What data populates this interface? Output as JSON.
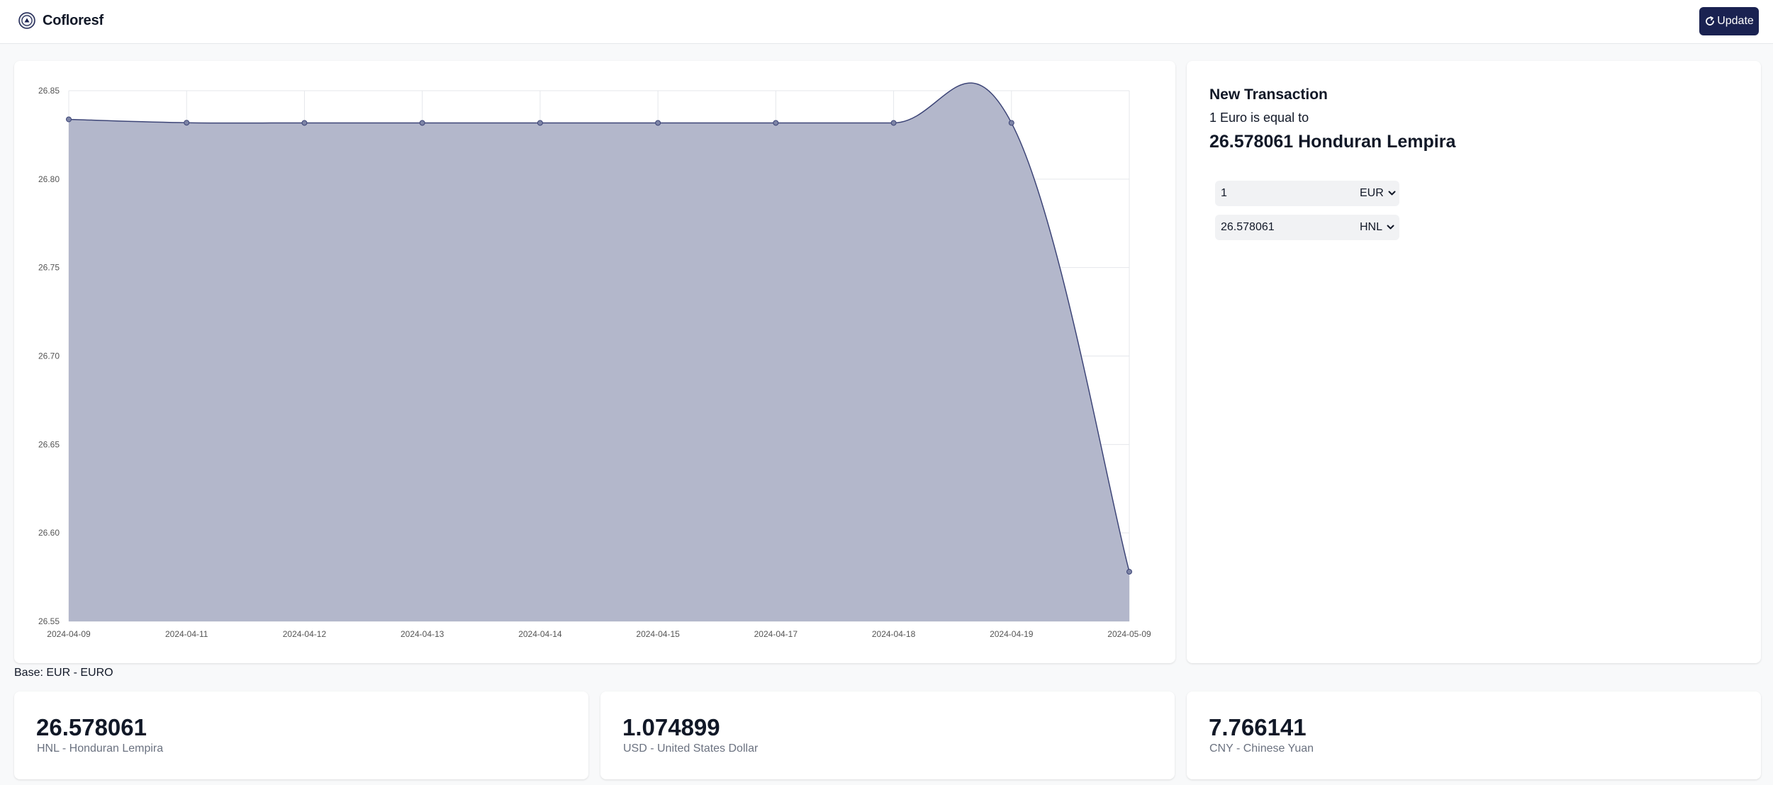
{
  "header": {
    "brand": "Cofloresf",
    "logo_icon": "coin-icon",
    "update_label": "Update",
    "update_icon": "refresh-icon",
    "accent_color": "#1a2251"
  },
  "chart_data": {
    "type": "area",
    "title": "",
    "xlabel": "",
    "ylabel": "",
    "categories": [
      "2024-04-09",
      "2024-04-11",
      "2024-04-12",
      "2024-04-13",
      "2024-04-14",
      "2024-04-15",
      "2024-04-17",
      "2024-04-18",
      "2024-04-19",
      "2024-05-09"
    ],
    "values": [
      26.8338,
      26.8319,
      26.8318,
      26.8318,
      26.8318,
      26.8318,
      26.8318,
      26.8318,
      26.8318,
      26.578061
    ],
    "ylim": [
      26.55,
      26.85
    ],
    "y_ticks": [
      "26.85",
      "26.80",
      "26.75",
      "26.70",
      "26.65",
      "26.60",
      "26.55"
    ],
    "grid": true,
    "fill_color": "#b3b7cb",
    "line_color": "#3d4577"
  },
  "base": {
    "label": "Base: EUR - EURO"
  },
  "transaction": {
    "title": "New Transaction",
    "subtitle": "1 Euro is equal to",
    "result": "26.578061 Honduran Lempira",
    "from": {
      "value": "1",
      "currency": "EUR"
    },
    "to": {
      "value": "26.578061",
      "currency": "HNL"
    },
    "select_icon": "chevron-down-icon"
  },
  "stats": [
    {
      "value": "26.578061",
      "label": "HNL - Honduran Lempira"
    },
    {
      "value": "1.074899",
      "label": "USD - United States Dollar"
    },
    {
      "value": "7.766141",
      "label": "CNY - Chinese Yuan"
    }
  ]
}
